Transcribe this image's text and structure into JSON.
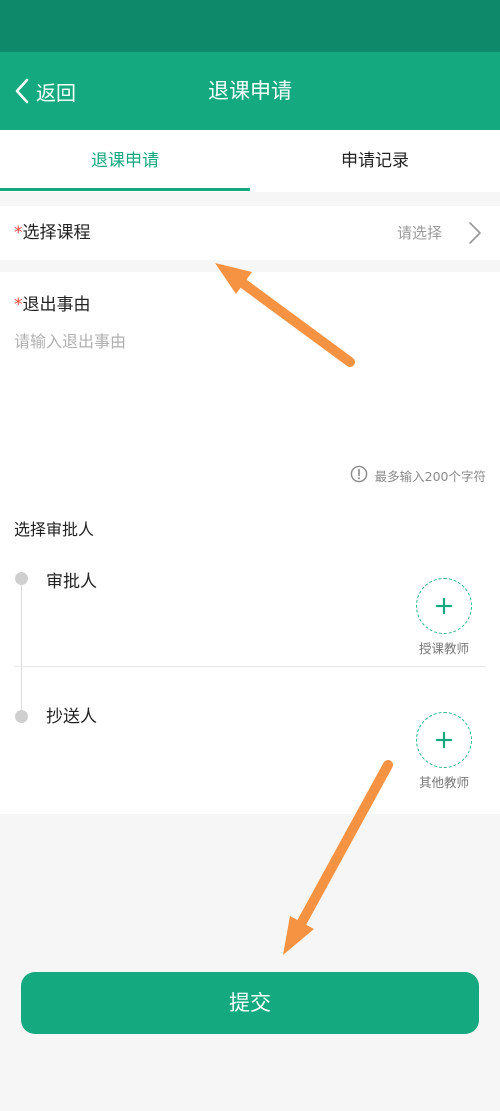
{
  "header": {
    "back_label": "返回",
    "title": "退课申请"
  },
  "tabs": [
    {
      "label": "退课申请",
      "active": true
    },
    {
      "label": "申请记录",
      "active": false
    }
  ],
  "form": {
    "required_mark": "*",
    "course": {
      "label": "选择课程",
      "value_placeholder": "请选择"
    },
    "reason": {
      "label": "退出事由",
      "placeholder": "请输入退出事由",
      "limit_note": "最多输入200个字符"
    },
    "approvers": {
      "title": "选择审批人",
      "approver": {
        "label": "审批人",
        "add_label": "授课教师"
      },
      "cc": {
        "label": "抄送人",
        "add_label": "其他教师"
      }
    },
    "submit_label": "提交"
  },
  "colors": {
    "primary": "#14a97e",
    "status_bar": "#0e8a6a",
    "required": "#e0463b",
    "annotation_arrow": "#f59343"
  }
}
